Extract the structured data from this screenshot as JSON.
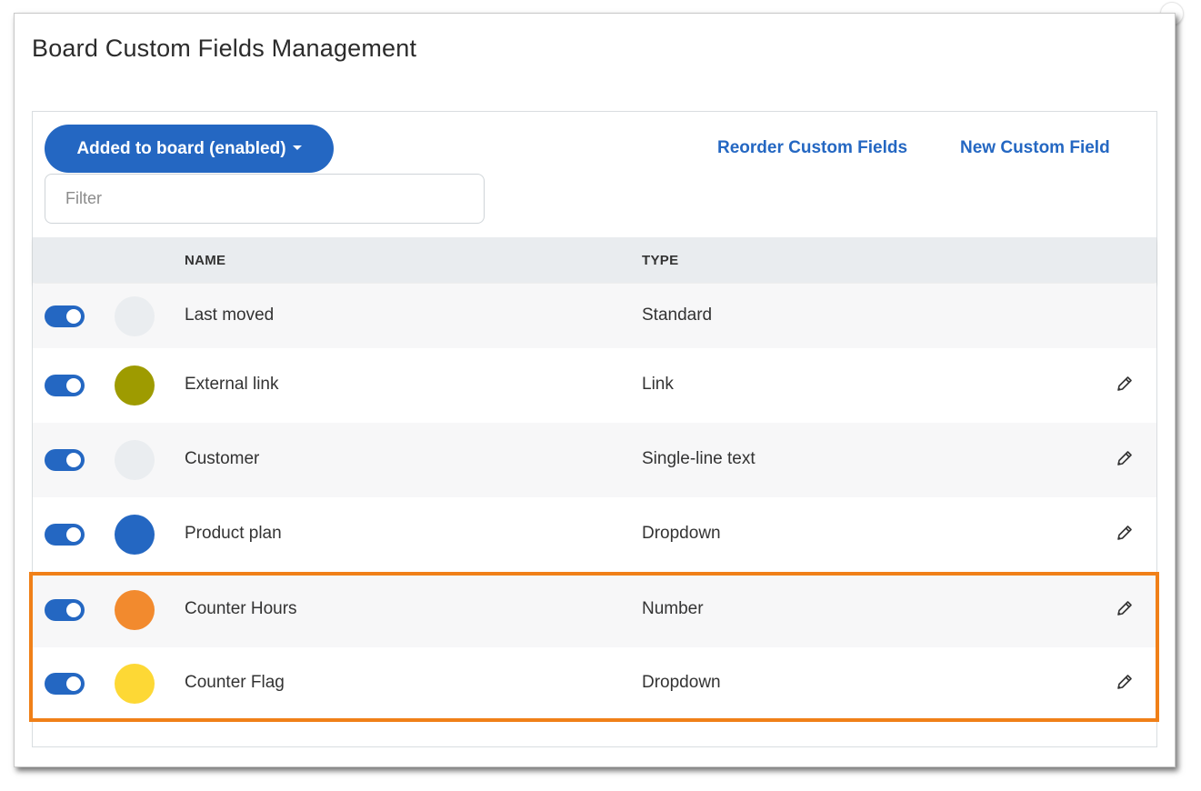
{
  "dialog": {
    "title": "Board Custom Fields Management"
  },
  "toolbar": {
    "filter_dropdown_label": "Added to board (enabled)",
    "reorder_label": "Reorder Custom Fields",
    "new_field_label": "New Custom Field",
    "filter_placeholder": "Filter"
  },
  "table": {
    "columns": [
      "NAME",
      "TYPE"
    ],
    "rows": [
      {
        "name": "Last moved",
        "type": "Standard",
        "color": "#eaedf0",
        "enabled": true,
        "editable": false
      },
      {
        "name": "External link",
        "type": "Link",
        "color": "#9e9b00",
        "enabled": true,
        "editable": true
      },
      {
        "name": "Customer",
        "type": "Single-line text",
        "color": "#eaedf0",
        "enabled": true,
        "editable": true
      },
      {
        "name": "Product plan",
        "type": "Dropdown",
        "color": "#2467c2",
        "enabled": true,
        "editable": true
      },
      {
        "name": "Counter Hours",
        "type": "Number",
        "color": "#f28a2e",
        "enabled": true,
        "editable": true
      },
      {
        "name": "Counter Flag",
        "type": "Dropdown",
        "color": "#fdd835",
        "enabled": true,
        "editable": true
      }
    ]
  },
  "colors": {
    "accent": "#2467c2",
    "highlight_border": "#f08018"
  },
  "icons": {
    "edit": "pencil-icon",
    "dropdown": "caret-down-icon"
  }
}
